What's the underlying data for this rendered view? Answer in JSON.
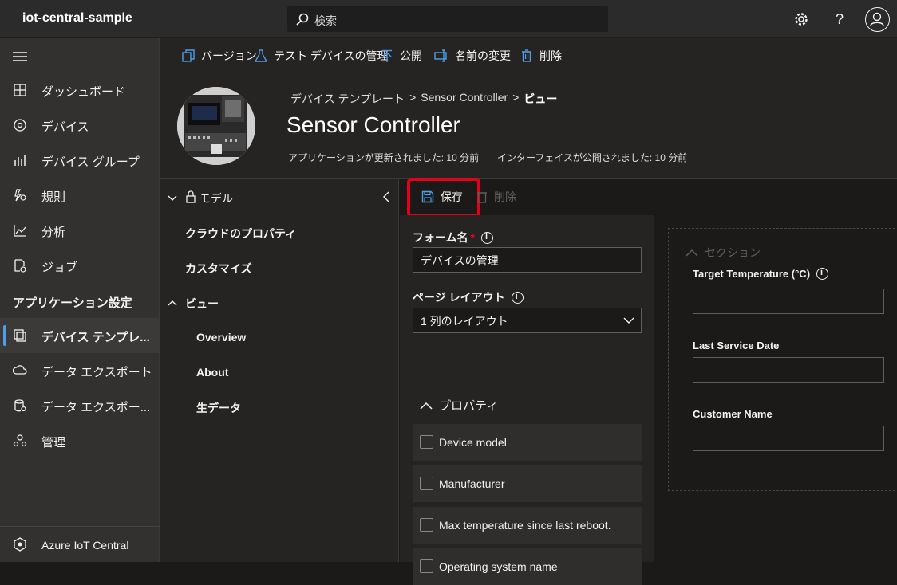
{
  "app": {
    "title": "iot-central-sample"
  },
  "search": {
    "placeholder": "検索"
  },
  "topbar": {
    "settings_icon": "gear-icon",
    "help_label": "?",
    "avatar_icon": "person-icon"
  },
  "sidebar": {
    "items": [
      {
        "label": "ダッシュボード",
        "icon": "dashboard-icon"
      },
      {
        "label": "デバイス",
        "icon": "device-icon"
      },
      {
        "label": "デバイス グループ",
        "icon": "device-group-icon"
      },
      {
        "label": "規則",
        "icon": "rules-icon"
      },
      {
        "label": "分析",
        "icon": "analytics-icon"
      },
      {
        "label": "ジョブ",
        "icon": "jobs-icon"
      }
    ],
    "section_heading": "アプリケーション設定",
    "settings_items": [
      {
        "label": "デバイス テンプレ...",
        "icon": "device-template-icon",
        "active": true
      },
      {
        "label": "データ エクスポート",
        "icon": "data-export-icon"
      },
      {
        "label": "データ エクスポー...",
        "icon": "data-export-legacy-icon"
      },
      {
        "label": "管理",
        "icon": "admin-icon"
      }
    ],
    "footer": {
      "label": "Azure IoT Central",
      "icon": "iot-central-icon"
    }
  },
  "commands": {
    "version": "バージョン",
    "test_devices": "テスト デバイスの管理",
    "publish": "公開",
    "rename": "名前の変更",
    "delete": "削除"
  },
  "header": {
    "breadcrumb": {
      "root": "デバイス テンプレート",
      "sep1": ">",
      "template": "Sensor Controller",
      "sep2": ">",
      "current": "ビュー"
    },
    "title": "Sensor Controller",
    "app_updated": "アプリケーションが更新されました: 10 分前",
    "interface_published": "インターフェイスが公開されました: 10 分前"
  },
  "tree": {
    "model": "モデル",
    "cloud_properties": "クラウドのプロパティ",
    "customize": "カスタマイズ",
    "views": "ビュー",
    "view_items": [
      "Overview",
      "About",
      "生データ"
    ]
  },
  "editor": {
    "save": "保存",
    "delete": "削除",
    "form_name_label": "フォーム名",
    "form_name_required": "*",
    "form_name_value": "デバイスの管理",
    "layout_label": "ページ レイアウト",
    "layout_value": "1 列のレイアウト",
    "properties_heading": "プロパティ",
    "properties": [
      "Device model",
      "Manufacturer",
      "Max temperature since last reboot.",
      "Operating system name"
    ],
    "section_title": "セクション",
    "fields": [
      "Target Temperature (°C)",
      "Last Service Date",
      "Customer Name"
    ]
  },
  "colors": {
    "accent": "#4f9ee8",
    "highlight": "#e3001b"
  }
}
